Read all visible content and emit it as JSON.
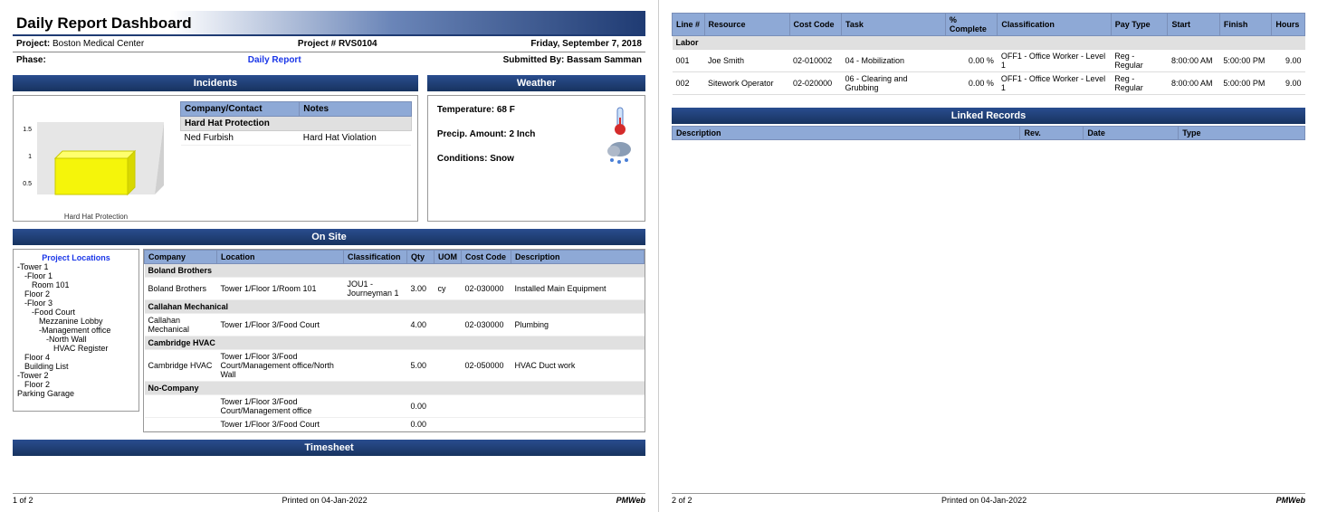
{
  "title": "Daily Report Dashboard",
  "header": {
    "project_label": "Project:",
    "project_value": "Boston Medical Center",
    "project_num_label": "Project #",
    "project_num_value": "RVS0104",
    "date": "Friday, September 7, 2018",
    "phase_label": "Phase:",
    "report_link": "Daily Report",
    "submitted_label": "Submitted By:",
    "submitted_value": "Bassam Samman"
  },
  "sections": {
    "incidents": "Incidents",
    "weather": "Weather",
    "onsite": "On Site",
    "timesheet": "Timesheet",
    "linked": "Linked Records"
  },
  "incidents_table": {
    "h1": "Company/Contact",
    "h2": "Notes",
    "group": "Hard Hat Protection",
    "r1c1": "Ned Furbish",
    "r1c2": "Hard Hat Violation"
  },
  "chart_data": {
    "type": "bar",
    "categories": [
      "Hard Hat Protection"
    ],
    "values": [
      1
    ],
    "ylim": [
      0,
      1.5
    ],
    "yticks": [
      0.5,
      1,
      1.5
    ],
    "title": "",
    "xlabel": "",
    "ylabel": ""
  },
  "chart_label": "Hard Hat Protection",
  "chart_ticks": {
    "t0": "0.5",
    "t1": "1",
    "t2": "1.5"
  },
  "weather": {
    "temp_label": "Temperature:",
    "temp_value": "68 F",
    "precip_label": "Precip. Amount:",
    "precip_value": "2 Inch",
    "cond_label": "Conditions:",
    "cond_value": "Snow"
  },
  "tree_title": "Project Locations",
  "tree": {
    "n0": "-Tower 1",
    "n1": "-Floor 1",
    "n2": "Room 101",
    "n3": "Floor 2",
    "n4": "-Floor 3",
    "n5": "-Food Court",
    "n6": "Mezzanine Lobby",
    "n7": "-Management office",
    "n8": "-North Wall",
    "n9": "HVAC Register",
    "n10": "Floor 4",
    "n11": "Building List",
    "n12": "-Tower 2",
    "n13": "Floor 2",
    "n14": "Parking Garage"
  },
  "onsite_cols": {
    "c0": "Company",
    "c1": "Location",
    "c2": "Classification",
    "c3": "Qty",
    "c4": "UOM",
    "c5": "Cost Code",
    "c6": "Description"
  },
  "onsite_groups": {
    "g0": "Boland Brothers",
    "g1": "Callahan Mechanical",
    "g2": "Cambridge HVAC",
    "g3": "No-Company"
  },
  "onsite_rows": {
    "r0": {
      "company": "Boland Brothers",
      "loc": "Tower 1/Floor 1/Room 101",
      "class": "JOU1 - Journeyman 1",
      "qty": "3.00",
      "uom": "cy",
      "cost": "02-030000",
      "desc": "Installed Main Equipment"
    },
    "r1": {
      "company": "Callahan Mechanical",
      "loc": "Tower 1/Floor 3/Food Court",
      "class": "",
      "qty": "4.00",
      "uom": "",
      "cost": "02-030000",
      "desc": "Plumbing"
    },
    "r2": {
      "company": "Cambridge HVAC",
      "loc": "Tower 1/Floor 3/Food Court/Management office/North Wall",
      "class": "",
      "qty": "5.00",
      "uom": "",
      "cost": "02-050000",
      "desc": "HVAC Duct work"
    },
    "r3": {
      "company": "",
      "loc": "Tower 1/Floor 3/Food Court/Management office",
      "class": "",
      "qty": "0.00",
      "uom": "",
      "cost": "",
      "desc": ""
    },
    "r4": {
      "company": "",
      "loc": "Tower 1/Floor 3/Food Court",
      "class": "",
      "qty": "0.00",
      "uom": "",
      "cost": "",
      "desc": ""
    }
  },
  "ts_cols": {
    "c0": "Line #",
    "c1": "Resource",
    "c2": "Cost Code",
    "c3": "Task",
    "c4": "% Complete",
    "c5": "Classification",
    "c6": "Pay Type",
    "c7": "Start",
    "c8": "Finish",
    "c9": "Hours"
  },
  "ts_group": "Labor",
  "ts_rows": {
    "r0": {
      "line": "001",
      "res": "Joe Smith",
      "cost": "02-010002",
      "task": "04 - Mobilization",
      "pct": "0.00 %",
      "class": "OFF1 - Office Worker - Level 1",
      "pay": "Reg - Regular",
      "start": "8:00:00 AM",
      "finish": "5:00:00 PM",
      "hours": "9.00"
    },
    "r1": {
      "line": "002",
      "res": "Sitework Operator",
      "cost": "02-020000",
      "task": "06 - Clearing and Grubbing",
      "pct": "0.00 %",
      "class": "OFF1 - Office Worker - Level 1",
      "pay": "Reg - Regular",
      "start": "8:00:00 AM",
      "finish": "5:00:00 PM",
      "hours": "9.00"
    }
  },
  "linked_cols": {
    "c0": "Description",
    "c1": "Rev.",
    "c2": "Date",
    "c3": "Type"
  },
  "footer": {
    "p1": "1 of 2",
    "p2": "2 of 2",
    "printed": "Printed on 04-Jan-2022",
    "brand": "PMWeb"
  }
}
